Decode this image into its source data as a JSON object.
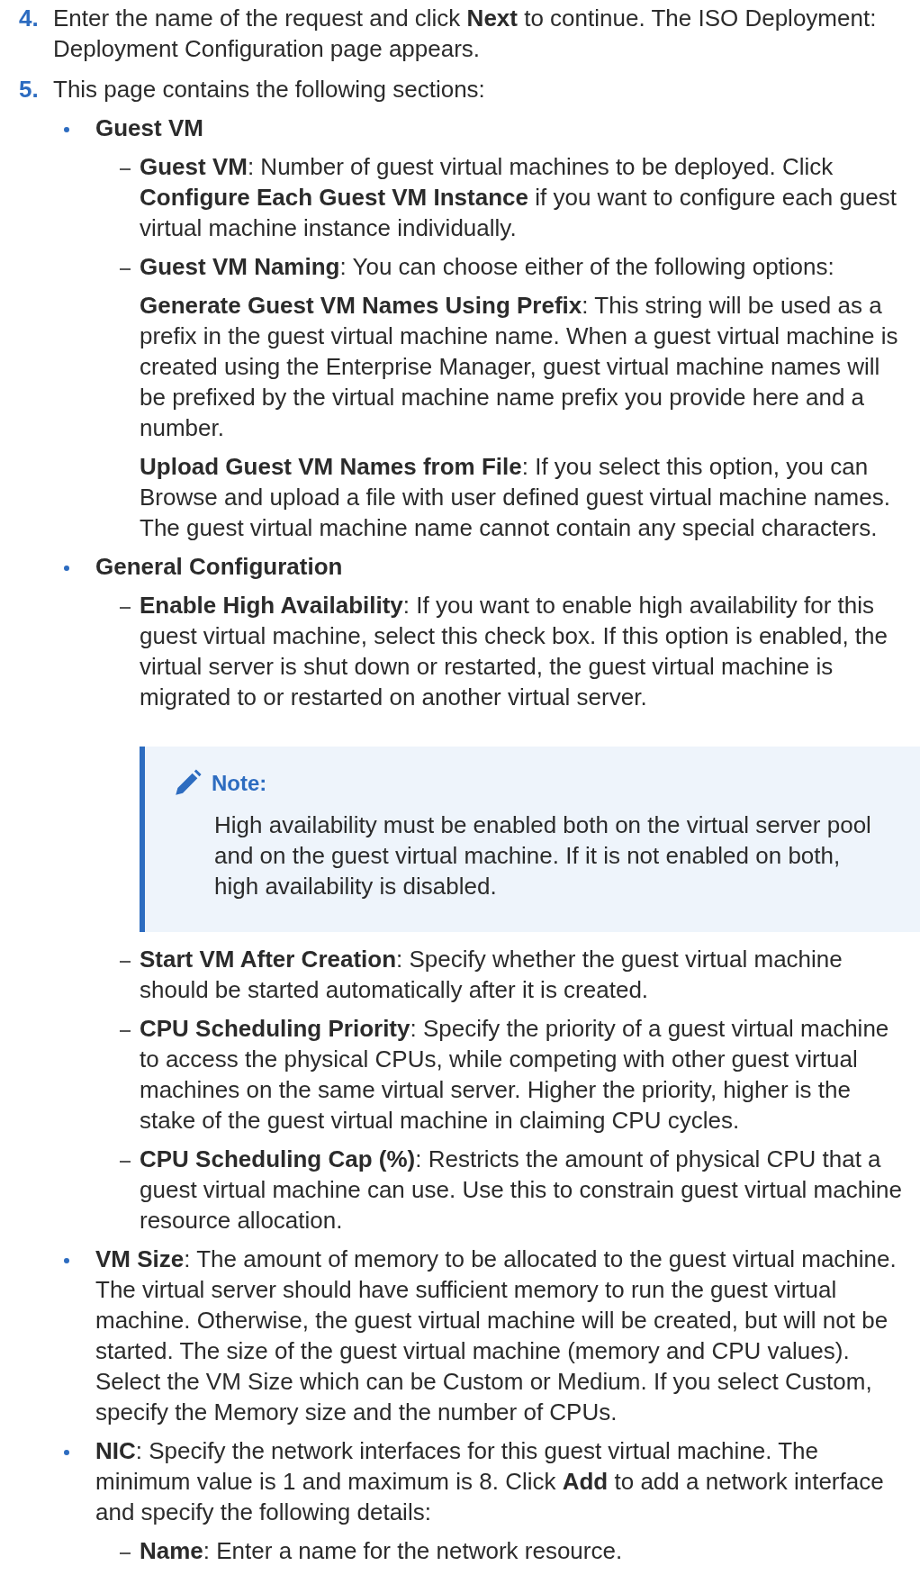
{
  "steps": [
    {
      "number": "4.",
      "text": "Enter the name of the request and click **Next** to continue. The ISO Deployment: Deployment Configuration page appears."
    },
    {
      "number": "5.",
      "text": "This page contains the following sections:",
      "items": [
        {
          "text": "**Guest VM**",
          "children": [
            {
              "text": "**Guest VM**: Number of guest virtual machines to be deployed. Click **Configure Each Guest VM Instance** if you want to configure each guest virtual machine instance individually."
            },
            {
              "text": "**Guest VM Naming**: You can choose either of the following options:",
              "paragraphs": [
                "**Generate Guest VM Names Using Prefix**: This string will be used as a prefix in the guest virtual machine name. When a guest virtual machine is created using the Enterprise Manager, guest virtual machine names will be prefixed by the virtual machine name prefix you provide here and a number.",
                "**Upload Guest VM Names from File**: If you select this option, you can Browse and upload a file with user defined guest virtual machine names. The guest virtual machine name cannot contain any special characters."
              ]
            }
          ]
        },
        {
          "text": "**General Configuration**",
          "children": [
            {
              "text": "**Enable High Availability**: If you want to enable high availability for this guest virtual machine, select this check box. If this option is enabled, the virtual server is shut down or restarted, the guest virtual machine is migrated to or restarted on another virtual server.",
              "note": {
                "title": "Note:",
                "text": "High availability must be enabled both on the virtual server pool and on the guest virtual machine. If it is not enabled on both, high availability is disabled."
              }
            },
            {
              "text": "**Start VM After Creation**: Specify whether the guest virtual machine should be started automatically after it is created."
            },
            {
              "text": "**CPU Scheduling Priority**: Specify the priority of a guest virtual machine to access the physical CPUs, while competing with other guest virtual machines on the same virtual server. Higher the priority, higher is the stake of the guest virtual machine in claiming CPU cycles."
            },
            {
              "text": "**CPU Scheduling Cap (%)**: Restricts the amount of physical CPU that a guest virtual machine can use. Use this to constrain guest virtual machine resource allocation."
            }
          ]
        },
        {
          "text": "**VM Size**: The amount of memory to be allocated to the guest virtual machine. The virtual server should have sufficient memory to run the guest virtual machine. Otherwise, the guest virtual machine will be created, but will not be started. The size of the guest virtual machine (memory and CPU values). Select the VM Size which can be Custom or Medium. If you select Custom, specify the Memory size and the number of CPUs."
        },
        {
          "text": "**NIC**: Specify the network interfaces for this guest virtual machine. The minimum value is 1 and maximum is 8. Click **Add** to add a network interface and specify the following details:",
          "children": [
            {
              "text": "**Name**: Enter a name for the network resource."
            }
          ]
        }
      ]
    }
  ]
}
